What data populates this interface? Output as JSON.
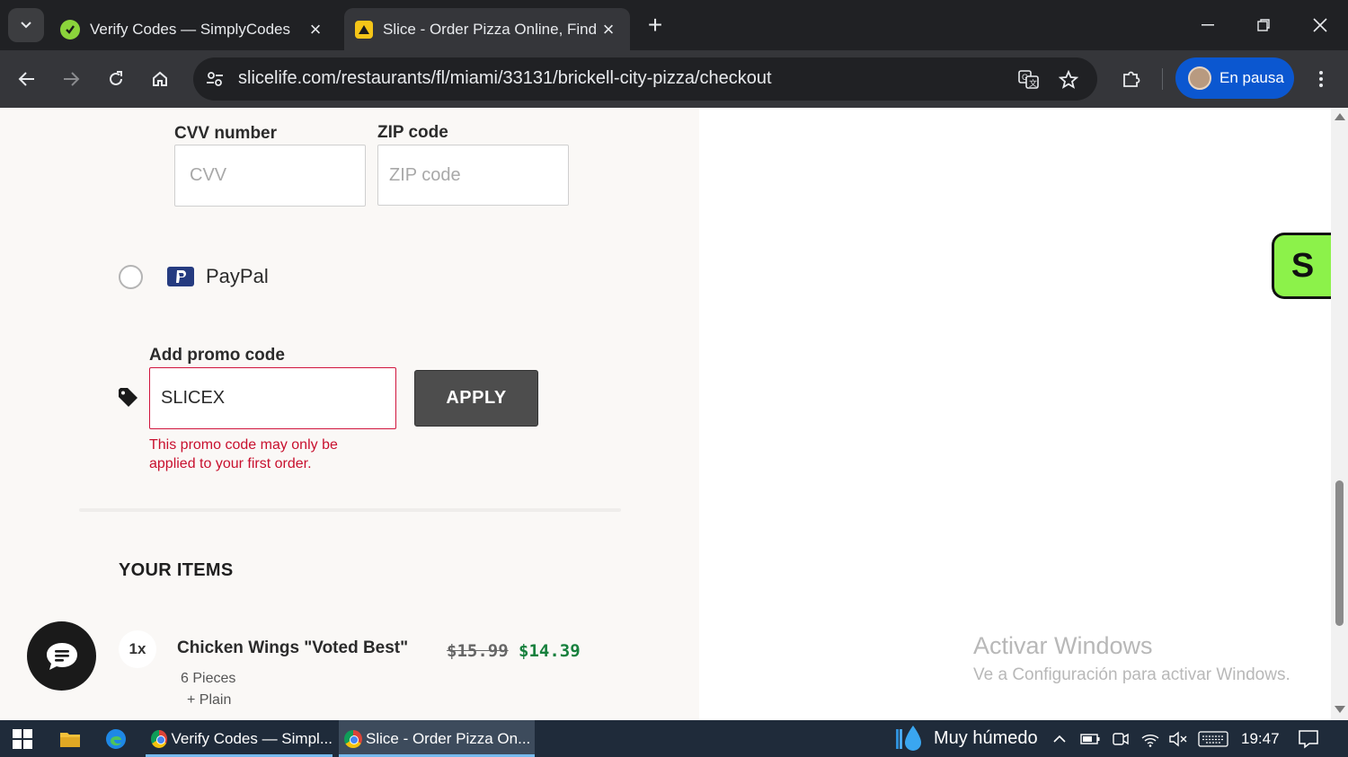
{
  "browser": {
    "tabs": [
      {
        "title": "Verify Codes — SimplyCodes",
        "active": false,
        "favicon": "simplycodes-icon"
      },
      {
        "title": "Slice - Order Pizza Online, Find",
        "active": true,
        "favicon": "slice-icon"
      }
    ],
    "new_tab_label": "+",
    "url": "slicelife.com/restaurants/fl/miami/33131/brickell-city-pizza/checkout",
    "profile_label": "En pausa"
  },
  "payment": {
    "cvv_label": "CVV number",
    "cvv_placeholder": "CVV",
    "zip_label": "ZIP code",
    "zip_placeholder": "ZIP code",
    "paypal_label": "PayPal"
  },
  "promo": {
    "label": "Add promo code",
    "value": "SLICEX",
    "apply_label": "APPLY",
    "error": "This promo code may only be applied to your first order."
  },
  "items": {
    "heading": "YOUR ITEMS",
    "list": [
      {
        "qty": "1x",
        "name": "Chicken Wings \"Voted Best\"",
        "old_price": "$15.99",
        "new_price": "$14.39",
        "details": [
          "6 Pieces",
          "+  Plain"
        ]
      }
    ]
  },
  "badge_letter": "S",
  "watermark": {
    "title": "Activar Windows",
    "subtitle": "Ve a Configuración para activar Windows."
  },
  "taskbar": {
    "apps": [
      {
        "label": "Verify Codes — Simpl...",
        "active": false
      },
      {
        "label": "Slice - Order Pizza On...",
        "active": true
      }
    ],
    "weather": "Muy húmedo",
    "time": "19:47"
  },
  "colors": {
    "error_red": "#c8102e",
    "price_green": "#17803d",
    "slice_green": "#8cf24a",
    "profile_blue": "#0b57d0"
  }
}
